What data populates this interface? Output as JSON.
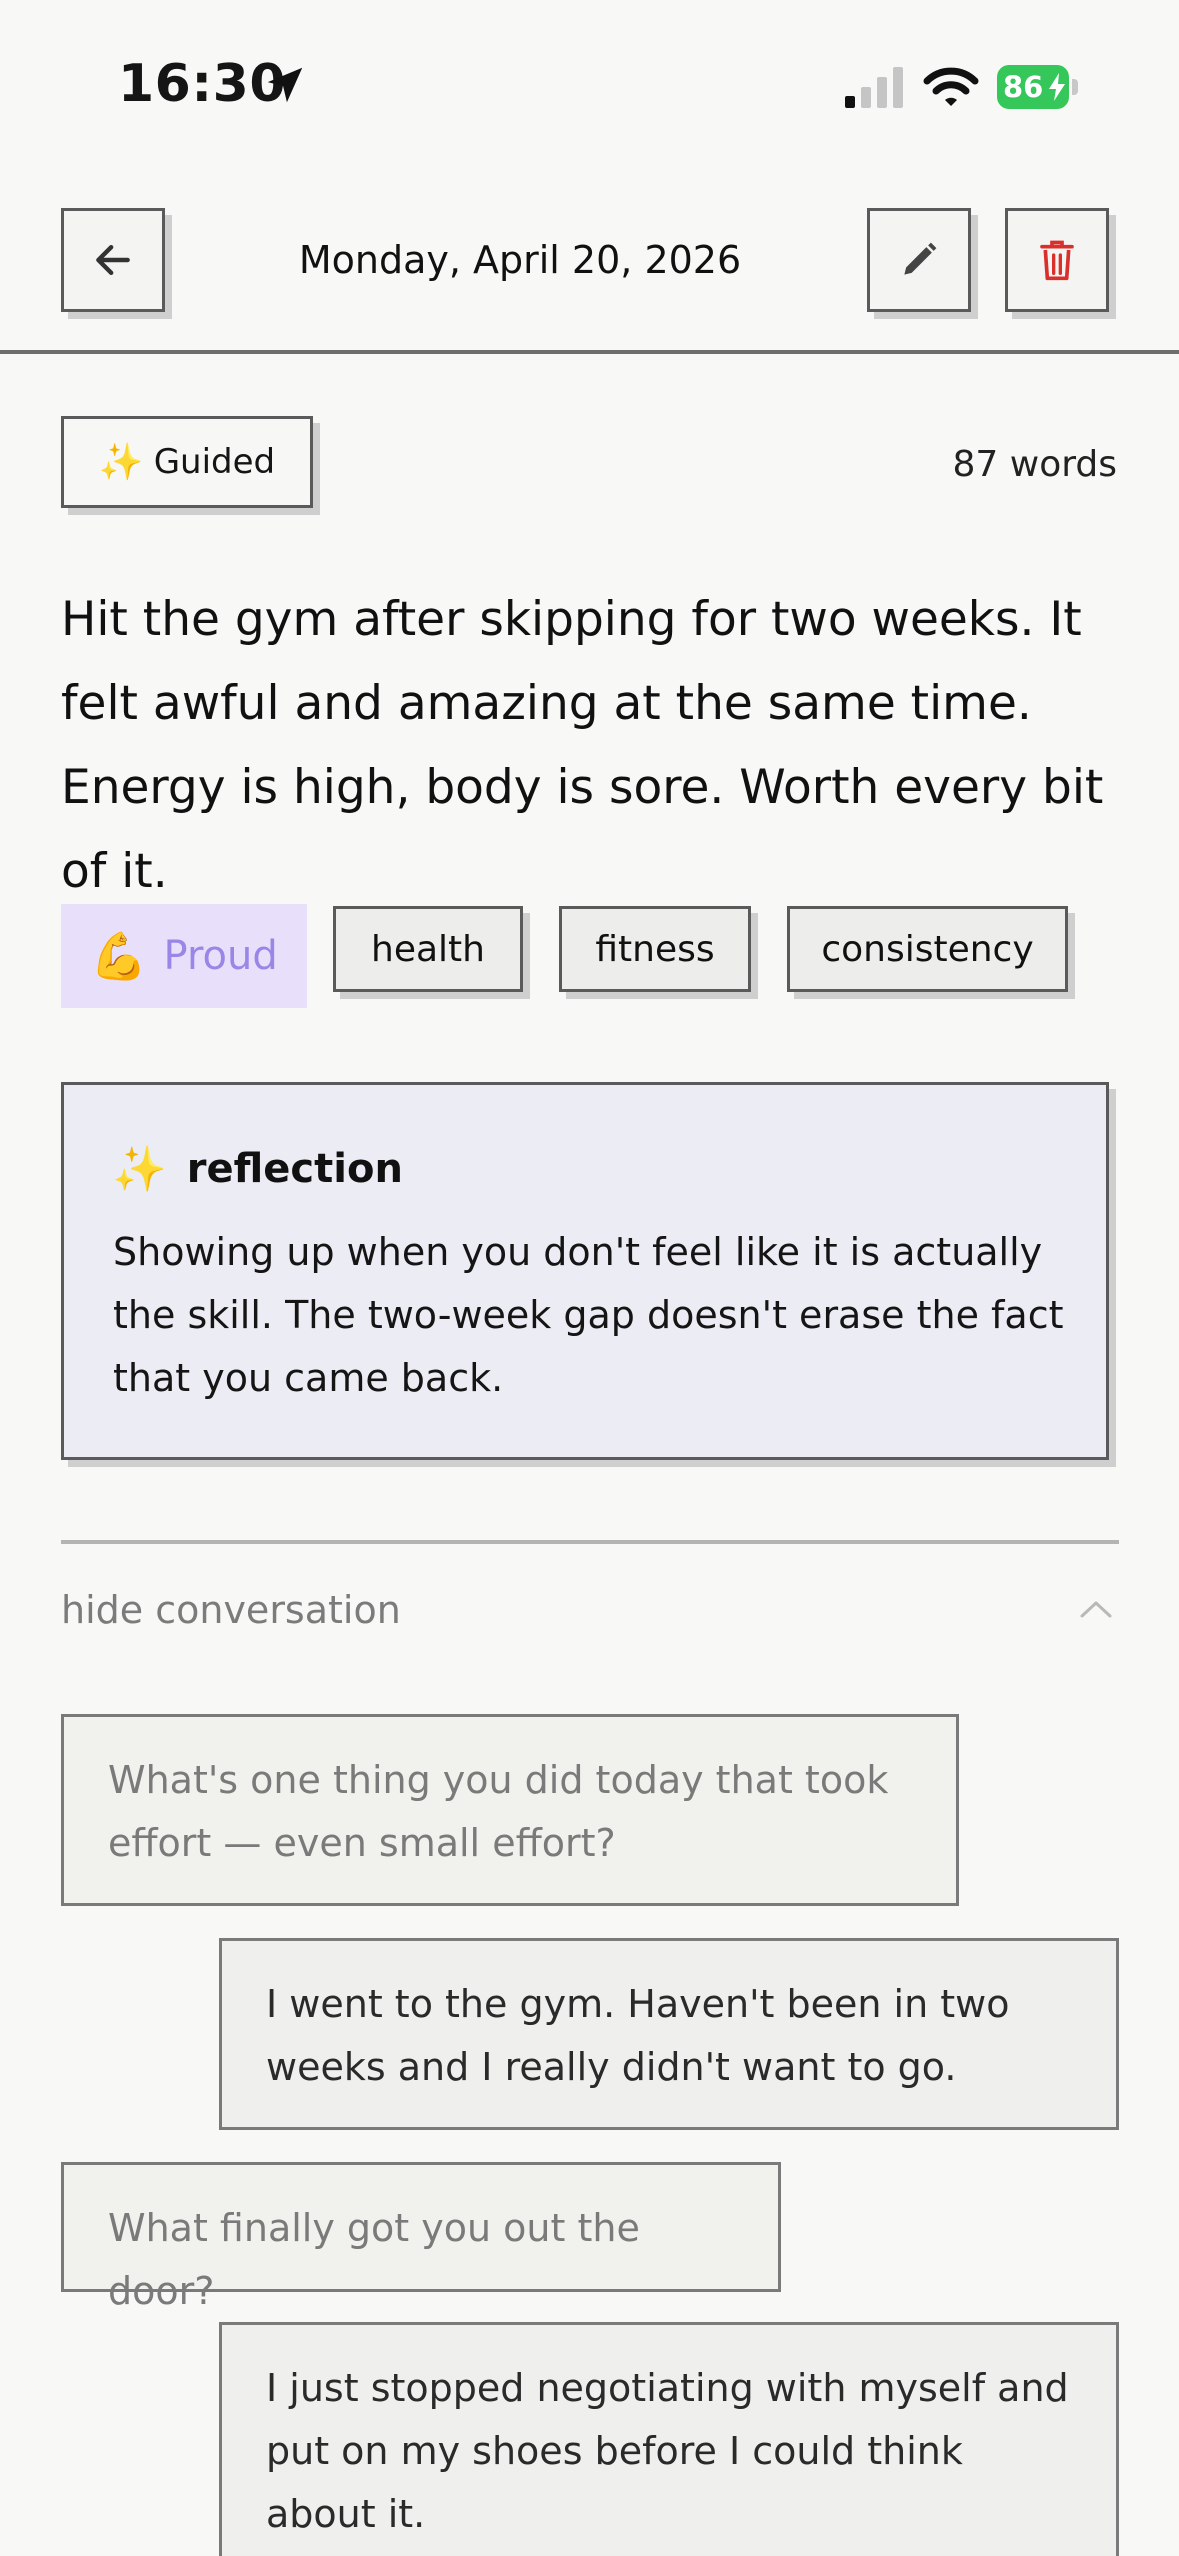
{
  "status_bar": {
    "time": "16:30",
    "battery_level": "86",
    "icons": [
      "location-arrow-icon",
      "cellular-signal-icon",
      "wifi-icon",
      "battery-charging-icon"
    ]
  },
  "header": {
    "date": "Monday, April 20, 2026",
    "icons": [
      "back-arrow-icon",
      "pencil-icon",
      "trash-icon"
    ]
  },
  "entry": {
    "mode_label": "Guided",
    "mode_icon": "sparkles-icon",
    "word_count": "87 words",
    "body": "Hit the gym after skipping for two weeks. It felt awful and amazing at the same time. Energy is high, body is sore. Worth every bit of it.",
    "mood": {
      "emoji": "💪",
      "label": "Proud"
    },
    "tags": [
      "health",
      "fitness",
      "consistency"
    ]
  },
  "reflection": {
    "title": "reflection",
    "body": "Showing up when you don't feel like it is actually the skill. The two-week gap doesn't erase the fact that you came back."
  },
  "conversation": {
    "toggle_label": "hide conversation",
    "messages": [
      {
        "role": "question",
        "text": "What's one thing you did today that took effort — even small effort?"
      },
      {
        "role": "answer",
        "text": "I went to the gym. Haven't been in two weeks and I really didn't want to go."
      },
      {
        "role": "question",
        "text": "What finally got you out the door?"
      },
      {
        "role": "answer",
        "text": "I just stopped negotiating with myself and put on my shoes before I could think about it."
      }
    ]
  },
  "colors": {
    "accent_mood_bg": "#e8e0fb",
    "accent_mood_text": "#9a86e6",
    "delete_red": "#d9302c",
    "battery_green": "#35c759",
    "reflection_bg": "#ececf4"
  }
}
